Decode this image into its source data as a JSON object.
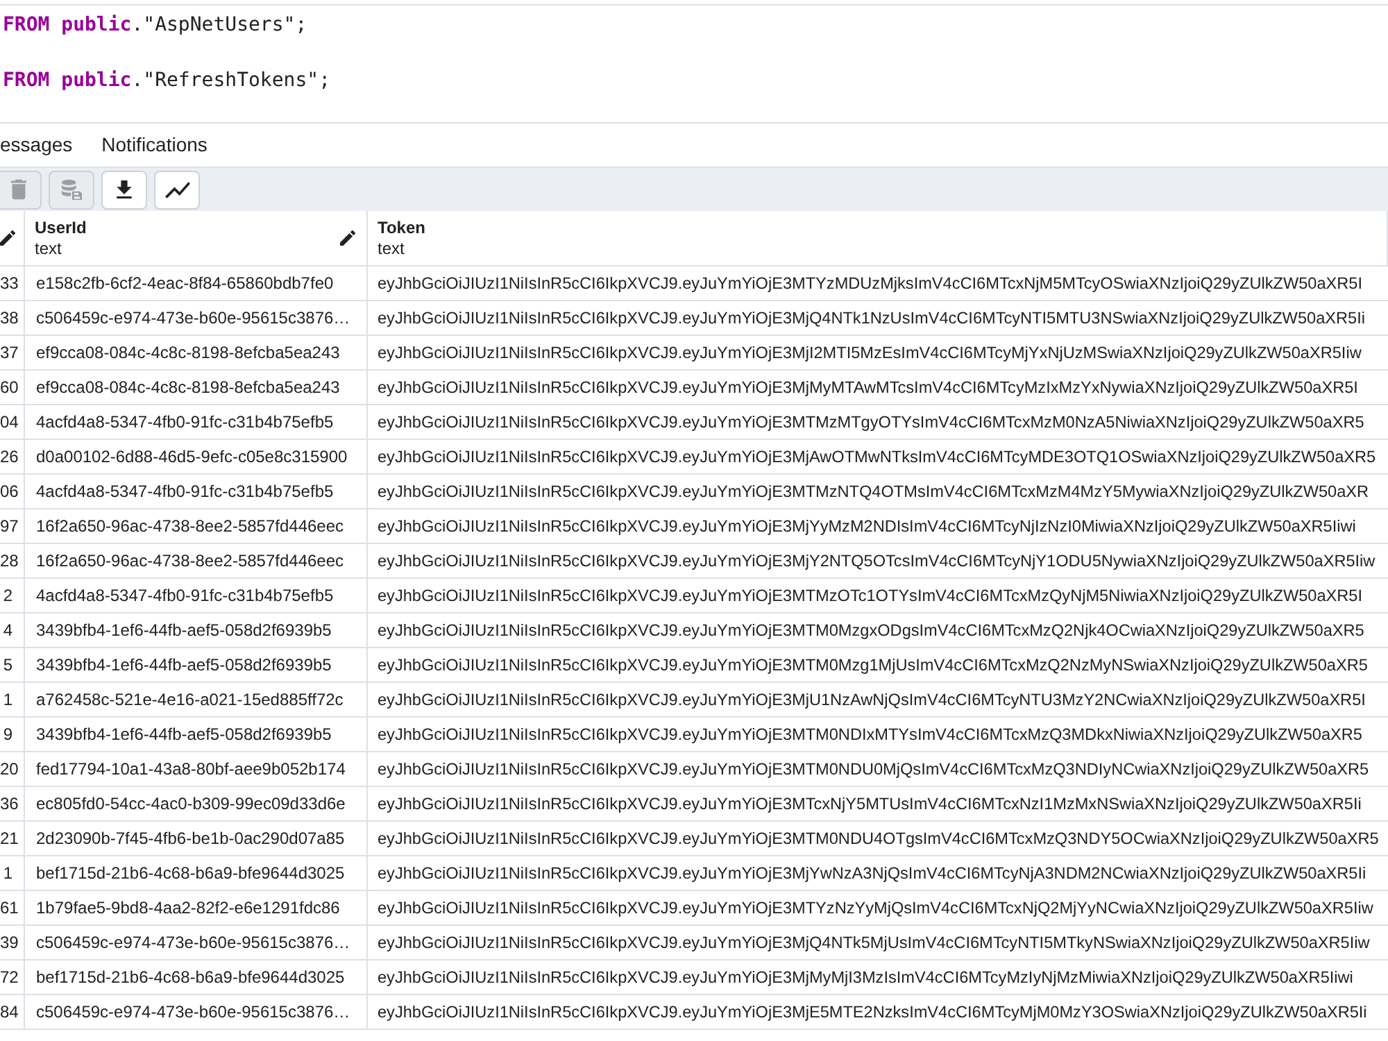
{
  "editor": {
    "lines": [
      {
        "kind": "code",
        "tokens": [
          {
            "kind": "keyword",
            "text": "FROM public"
          },
          {
            "kind": "plain",
            "text": ".\"AspNetUsers\";"
          }
        ]
      },
      {
        "kind": "blank"
      },
      {
        "kind": "code",
        "tokens": [
          {
            "kind": "keyword",
            "text": "FROM public"
          },
          {
            "kind": "plain",
            "text": ".\"RefreshTokens\";"
          }
        ]
      }
    ]
  },
  "tabs": [
    {
      "label": "essages",
      "selected": false
    },
    {
      "label": "Notifications",
      "selected": false
    }
  ],
  "toolbar": [
    {
      "kind": "delete",
      "disabled": true
    },
    {
      "kind": "save",
      "disabled": true
    },
    {
      "kind": "download",
      "disabled": false
    },
    {
      "kind": "graph",
      "disabled": false
    }
  ],
  "table": {
    "columns": [
      {
        "editable": true
      },
      {
        "name": "UserId",
        "type": "text",
        "editable": true
      },
      {
        "name": "Token",
        "type": "text",
        "editable": false
      }
    ],
    "rows": [
      {
        "cells": [
          "33",
          "e158c2fb-6cf2-4eac-8f84-65860bdb7fe0",
          "eyJhbGciOiJIUzI1NiIsInR5cCI6IkpXVCJ9.eyJuYmYiOjE3MTYzMDUzMjksImV4cCI6MTcxNjM5MTcyOSwiaXNzIjoiQ29yZUlkZW50aXR5I"
        ]
      },
      {
        "cells": [
          "38",
          "c506459c-e974-473e-b60e-95615c3876…",
          "eyJhbGciOiJIUzI1NiIsInR5cCI6IkpXVCJ9.eyJuYmYiOjE3MjQ4NTk1NzUsImV4cCI6MTcyNTI5MTU3NSwiaXNzIjoiQ29yZUlkZW50aXR5Ii"
        ]
      },
      {
        "cells": [
          "37",
          "ef9cca08-084c-4c8c-8198-8efcba5ea243",
          "eyJhbGciOiJIUzI1NiIsInR5cCI6IkpXVCJ9.eyJuYmYiOjE3MjI2MTI5MzEsImV4cCI6MTcyMjYxNjUzMSwiaXNzIjoiQ29yZUlkZW50aXR5Iiw"
        ]
      },
      {
        "cells": [
          "60",
          "ef9cca08-084c-4c8c-8198-8efcba5ea243",
          "eyJhbGciOiJIUzI1NiIsInR5cCI6IkpXVCJ9.eyJuYmYiOjE3MjMyMTAwMTcsImV4cCI6MTcyMzIxMzYxNywiaXNzIjoiQ29yZUlkZW50aXR5I"
        ]
      },
      {
        "cells": [
          "04",
          "4acfd4a8-5347-4fb0-91fc-c31b4b75efb5",
          "eyJhbGciOiJIUzI1NiIsInR5cCI6IkpXVCJ9.eyJuYmYiOjE3MTMzMTgyOTYsImV4cCI6MTcxMzM0NzA5NiwiaXNzIjoiQ29yZUlkZW50aXR5"
        ]
      },
      {
        "cells": [
          "26",
          "d0a00102-6d88-46d5-9efc-c05e8c315900",
          "eyJhbGciOiJIUzI1NiIsInR5cCI6IkpXVCJ9.eyJuYmYiOjE3MjAwOTMwNTksImV4cCI6MTcyMDE3OTQ1OSwiaXNzIjoiQ29yZUlkZW50aXR5"
        ]
      },
      {
        "cells": [
          "06",
          "4acfd4a8-5347-4fb0-91fc-c31b4b75efb5",
          "eyJhbGciOiJIUzI1NiIsInR5cCI6IkpXVCJ9.eyJuYmYiOjE3MTMzNTQ4OTMsImV4cCI6MTcxMzM4MzY5MywiaXNzIjoiQ29yZUlkZW50aXR"
        ]
      },
      {
        "cells": [
          "97",
          "16f2a650-96ac-4738-8ee2-5857fd446eec",
          "eyJhbGciOiJIUzI1NiIsInR5cCI6IkpXVCJ9.eyJuYmYiOjE3MjYyMzM2NDIsImV4cCI6MTcyNjIzNzI0MiwiaXNzIjoiQ29yZUlkZW50aXR5Iiwi"
        ]
      },
      {
        "cells": [
          "28",
          "16f2a650-96ac-4738-8ee2-5857fd446eec",
          "eyJhbGciOiJIUzI1NiIsInR5cCI6IkpXVCJ9.eyJuYmYiOjE3MjY2NTQ5OTcsImV4cCI6MTcyNjY1ODU5NywiaXNzIjoiQ29yZUlkZW50aXR5Iiw"
        ]
      },
      {
        "cells": [
          "2",
          "4acfd4a8-5347-4fb0-91fc-c31b4b75efb5",
          "eyJhbGciOiJIUzI1NiIsInR5cCI6IkpXVCJ9.eyJuYmYiOjE3MTMzOTc1OTYsImV4cCI6MTcxMzQyNjM5NiwiaXNzIjoiQ29yZUlkZW50aXR5I"
        ]
      },
      {
        "cells": [
          "4",
          "3439bfb4-1ef6-44fb-aef5-058d2f6939b5",
          "eyJhbGciOiJIUzI1NiIsInR5cCI6IkpXVCJ9.eyJuYmYiOjE3MTM0MzgxODgsImV4cCI6MTcxMzQ2Njk4OCwiaXNzIjoiQ29yZUlkZW50aXR5"
        ]
      },
      {
        "cells": [
          "5",
          "3439bfb4-1ef6-44fb-aef5-058d2f6939b5",
          "eyJhbGciOiJIUzI1NiIsInR5cCI6IkpXVCJ9.eyJuYmYiOjE3MTM0Mzg1MjUsImV4cCI6MTcxMzQ2NzMyNSwiaXNzIjoiQ29yZUlkZW50aXR5"
        ]
      },
      {
        "cells": [
          "1",
          "a762458c-521e-4e16-a021-15ed885ff72c",
          "eyJhbGciOiJIUzI1NiIsInR5cCI6IkpXVCJ9.eyJuYmYiOjE3MjU1NzAwNjQsImV4cCI6MTcyNTU3MzY2NCwiaXNzIjoiQ29yZUlkZW50aXR5I"
        ]
      },
      {
        "cells": [
          "9",
          "3439bfb4-1ef6-44fb-aef5-058d2f6939b5",
          "eyJhbGciOiJIUzI1NiIsInR5cCI6IkpXVCJ9.eyJuYmYiOjE3MTM0NDIxMTYsImV4cCI6MTcxMzQ3MDkxNiwiaXNzIjoiQ29yZUlkZW50aXR5"
        ]
      },
      {
        "cells": [
          "20",
          "fed17794-10a1-43a8-80bf-aee9b052b174",
          "eyJhbGciOiJIUzI1NiIsInR5cCI6IkpXVCJ9.eyJuYmYiOjE3MTM0NDU0MjQsImV4cCI6MTcxMzQ3NDIyNCwiaXNzIjoiQ29yZUlkZW50aXR5"
        ]
      },
      {
        "cells": [
          "36",
          "ec805fd0-54cc-4ac0-b309-99ec09d33d6e",
          "eyJhbGciOiJIUzI1NiIsInR5cCI6IkpXVCJ9.eyJuYmYiOjE3MTcxNjY5MTUsImV4cCI6MTcxNzI1MzMxNSwiaXNzIjoiQ29yZUlkZW50aXR5Ii"
        ]
      },
      {
        "cells": [
          "21",
          "2d23090b-7f45-4fb6-be1b-0ac290d07a85",
          "eyJhbGciOiJIUzI1NiIsInR5cCI6IkpXVCJ9.eyJuYmYiOjE3MTM0NDU4OTgsImV4cCI6MTcxMzQ3NDY5OCwiaXNzIjoiQ29yZUlkZW50aXR5"
        ]
      },
      {
        "cells": [
          "1",
          "bef1715d-21b6-4c68-b6a9-bfe9644d3025",
          "eyJhbGciOiJIUzI1NiIsInR5cCI6IkpXVCJ9.eyJuYmYiOjE3MjYwNzA3NjQsImV4cCI6MTcyNjA3NDM2NCwiaXNzIjoiQ29yZUlkZW50aXR5Ii"
        ]
      },
      {
        "cells": [
          "61",
          "1b79fae5-9bd8-4aa2-82f2-e6e1291fdc86",
          "eyJhbGciOiJIUzI1NiIsInR5cCI6IkpXVCJ9.eyJuYmYiOjE3MTYzNzYyMjQsImV4cCI6MTcxNjQ2MjYyNCwiaXNzIjoiQ29yZUlkZW50aXR5Iiw"
        ]
      },
      {
        "cells": [
          "39",
          "c506459c-e974-473e-b60e-95615c3876…",
          "eyJhbGciOiJIUzI1NiIsInR5cCI6IkpXVCJ9.eyJuYmYiOjE3MjQ4NTk5MjUsImV4cCI6MTcyNTI5MTkyNSwiaXNzIjoiQ29yZUlkZW50aXR5Iiw"
        ]
      },
      {
        "cells": [
          "72",
          "bef1715d-21b6-4c68-b6a9-bfe9644d3025",
          "eyJhbGciOiJIUzI1NiIsInR5cCI6IkpXVCJ9.eyJuYmYiOjE3MjMyMjI3MzIsImV4cCI6MTcyMzIyNjMzMiwiaXNzIjoiQ29yZUlkZW50aXR5Iiwi"
        ]
      },
      {
        "cells": [
          "84",
          "c506459c-e974-473e-b60e-95615c3876…",
          "eyJhbGciOiJIUzI1NiIsInR5cCI6IkpXVCJ9.eyJuYmYiOjE3MjE5MTE2NzksImV4cCI6MTcyMjM0MzY3OSwiaXNzIjoiQ29yZUlkZW50aXR5Ii"
        ]
      }
    ]
  }
}
